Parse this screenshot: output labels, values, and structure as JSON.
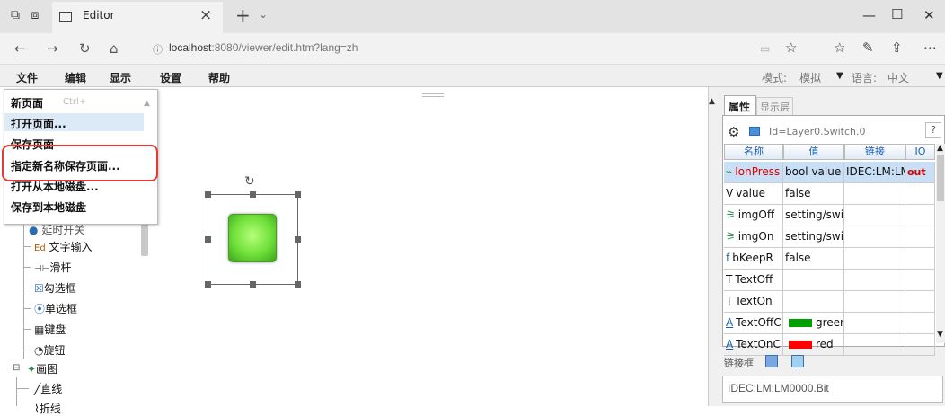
{
  "browser": {
    "tab_title": "Editor",
    "url_host": "localhost",
    "url_rest": ":8080/viewer/edit.htm?lang=zh"
  },
  "menubar": {
    "items": [
      "文件",
      "编辑",
      "显示",
      "设置",
      "帮助"
    ],
    "mode_label": "模式:",
    "mode_value": "模拟",
    "lang_label": "语言:",
    "lang_value": "中文"
  },
  "file_menu": {
    "items": [
      "新页面",
      "打开页面...",
      "保存页面",
      "指定新名称保存页面...",
      "打开从本地磁盘...",
      "保存到本地磁盘"
    ],
    "shortcut": "Ctrl+"
  },
  "tree": {
    "items": [
      "延时开关",
      "文字输入",
      "滑杆",
      "勾选框",
      "单选框",
      "键盘",
      "旋钮",
      "画图",
      "直线",
      "折线"
    ]
  },
  "panel": {
    "tab_properties": "属性",
    "tab_layers": "显示层",
    "id_text": "Id=Layer0.Switch.0",
    "help": "?",
    "columns": [
      "名称",
      "值",
      "链接",
      "IO"
    ],
    "rows": [
      {
        "icon": "⌁",
        "name": "IonPress",
        "value": "bool value",
        "link": "IDEC:LM:LM",
        "io": "out"
      },
      {
        "icon": "V",
        "name": "value",
        "value": "false",
        "link": "",
        "io": ""
      },
      {
        "icon": "img",
        "name": "imgOff",
        "value": "setting/switch",
        "link": "",
        "io": ""
      },
      {
        "icon": "img",
        "name": "imgOn",
        "value": "setting/switch",
        "link": "",
        "io": ""
      },
      {
        "icon": "f",
        "name": "bKeepR",
        "value": "false",
        "link": "",
        "io": ""
      },
      {
        "icon": "T",
        "name": "TextOff",
        "value": "",
        "link": "",
        "io": ""
      },
      {
        "icon": "T",
        "name": "TextOn",
        "value": "",
        "link": "",
        "io": ""
      },
      {
        "icon": "A",
        "name": "TextOffC",
        "value": "green",
        "link": "",
        "io": "",
        "swatch": "#00a000"
      },
      {
        "icon": "A",
        "name": "TextOnC",
        "value": "red",
        "link": "",
        "io": "",
        "swatch": "#ff0000"
      }
    ],
    "link_label": "链接框",
    "link_value": "IDEC:LM:LM0000.Bit"
  },
  "colors": {
    "accent": "#1a5fb4",
    "highlight_box": "#e53935",
    "switch_green": "#6fe03a"
  }
}
